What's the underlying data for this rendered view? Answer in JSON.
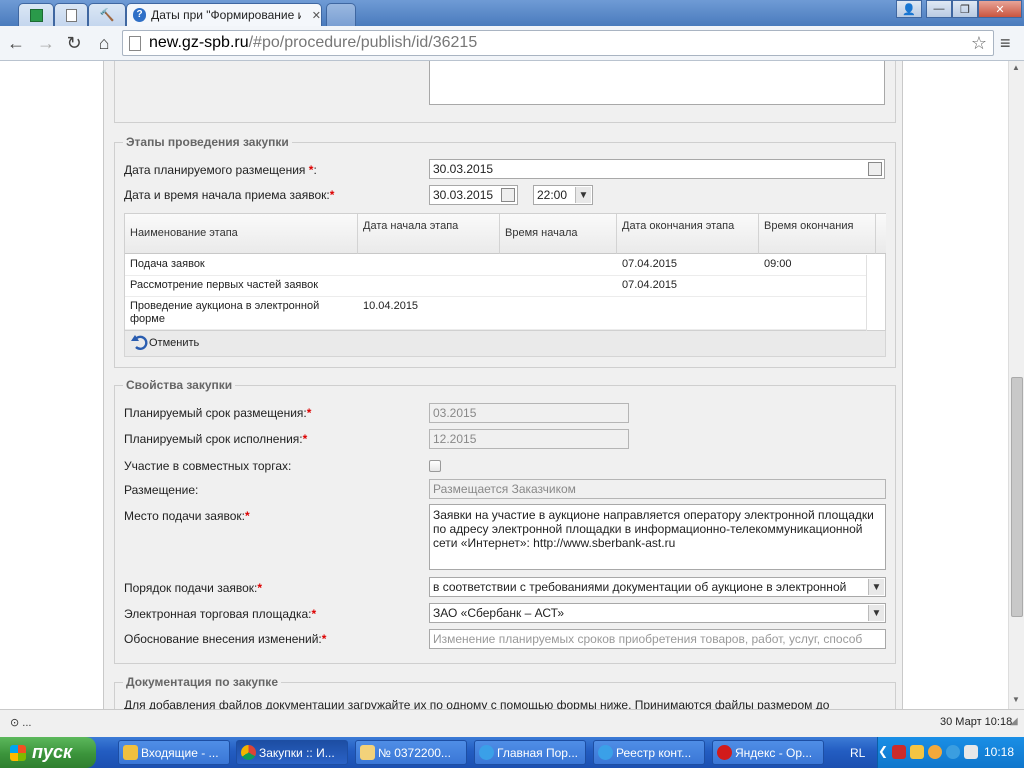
{
  "browser": {
    "active_tab_title": "Даты при \"Формирование и",
    "url_host": "new.gz-spb.ru",
    "url_path": "/#po/procedure/publish/id/36215"
  },
  "stages": {
    "legend": "Этапы проведения закупки",
    "planned_date_label": "Дата планируемого размещения",
    "planned_date_value": "30.03.2015",
    "start_label": "Дата и время начала приема заявок:",
    "start_date_value": "30.03.2015",
    "start_time_value": "22:00",
    "grid": {
      "headers": [
        "Наименование этапа",
        "Дата начала этапа",
        "Время начала",
        "Дата окончания этапа",
        "Время окончания"
      ],
      "rows": [
        {
          "name": "Подача заявок",
          "start_date": "",
          "start_time": "",
          "end_date": "07.04.2015",
          "end_time": "09:00"
        },
        {
          "name": "Рассмотрение первых частей заявок",
          "start_date": "",
          "start_time": "",
          "end_date": "07.04.2015",
          "end_time": ""
        },
        {
          "name": "Проведение аукциона в электронной форме",
          "start_date": "10.04.2015",
          "start_time": "",
          "end_date": "",
          "end_time": ""
        }
      ]
    },
    "cancel_label": "Отменить"
  },
  "properties": {
    "legend": "Свойства закупки",
    "placement_term_label": "Планируемый срок размещения:",
    "placement_term_value": "03.2015",
    "execution_term_label": "Планируемый срок исполнения:",
    "execution_term_value": "12.2015",
    "joint_label": "Участие в совместных торгах:",
    "placement_label": "Размещение:",
    "placement_value": "Размещается Заказчиком",
    "submission_place_label": "Место подачи заявок:",
    "submission_place_value": "Заявки на участие в аукционе направляется оператору электронной площадки по адресу электронной площадки в информационно-телекоммуникационной сети «Интернет»: http://www.sberbank-ast.ru",
    "order_label": "Порядок подачи заявок:",
    "order_value": "в соответствии с требованиями документации об аукционе в электронной",
    "etp_label": "Электронная торговая площадка:",
    "etp_value": "ЗАО «Сбербанк – АСТ»",
    "reason_label": "Обоснование внесения изменений:",
    "reason_placeholder": "Изменение планируемых сроков приобретения товаров, работ, услуг, способ"
  },
  "docs": {
    "legend": "Документация по закупке",
    "text": "Для добавления файлов документации загружайте их по одному с помощью формы ниже. Принимаются файлы размером до"
  },
  "statusbar": {
    "left": "⊙ ...",
    "right": "30 Март 10:18"
  },
  "taskbar": {
    "start_label": "пуск",
    "tasks": [
      "Входящие - ...",
      "Закупки :: И...",
      "№ 0372200...",
      "Главная Пор...",
      "Реестр конт...",
      "Яндекс - Ор..."
    ],
    "lang": "RL",
    "clock": "10:18"
  }
}
